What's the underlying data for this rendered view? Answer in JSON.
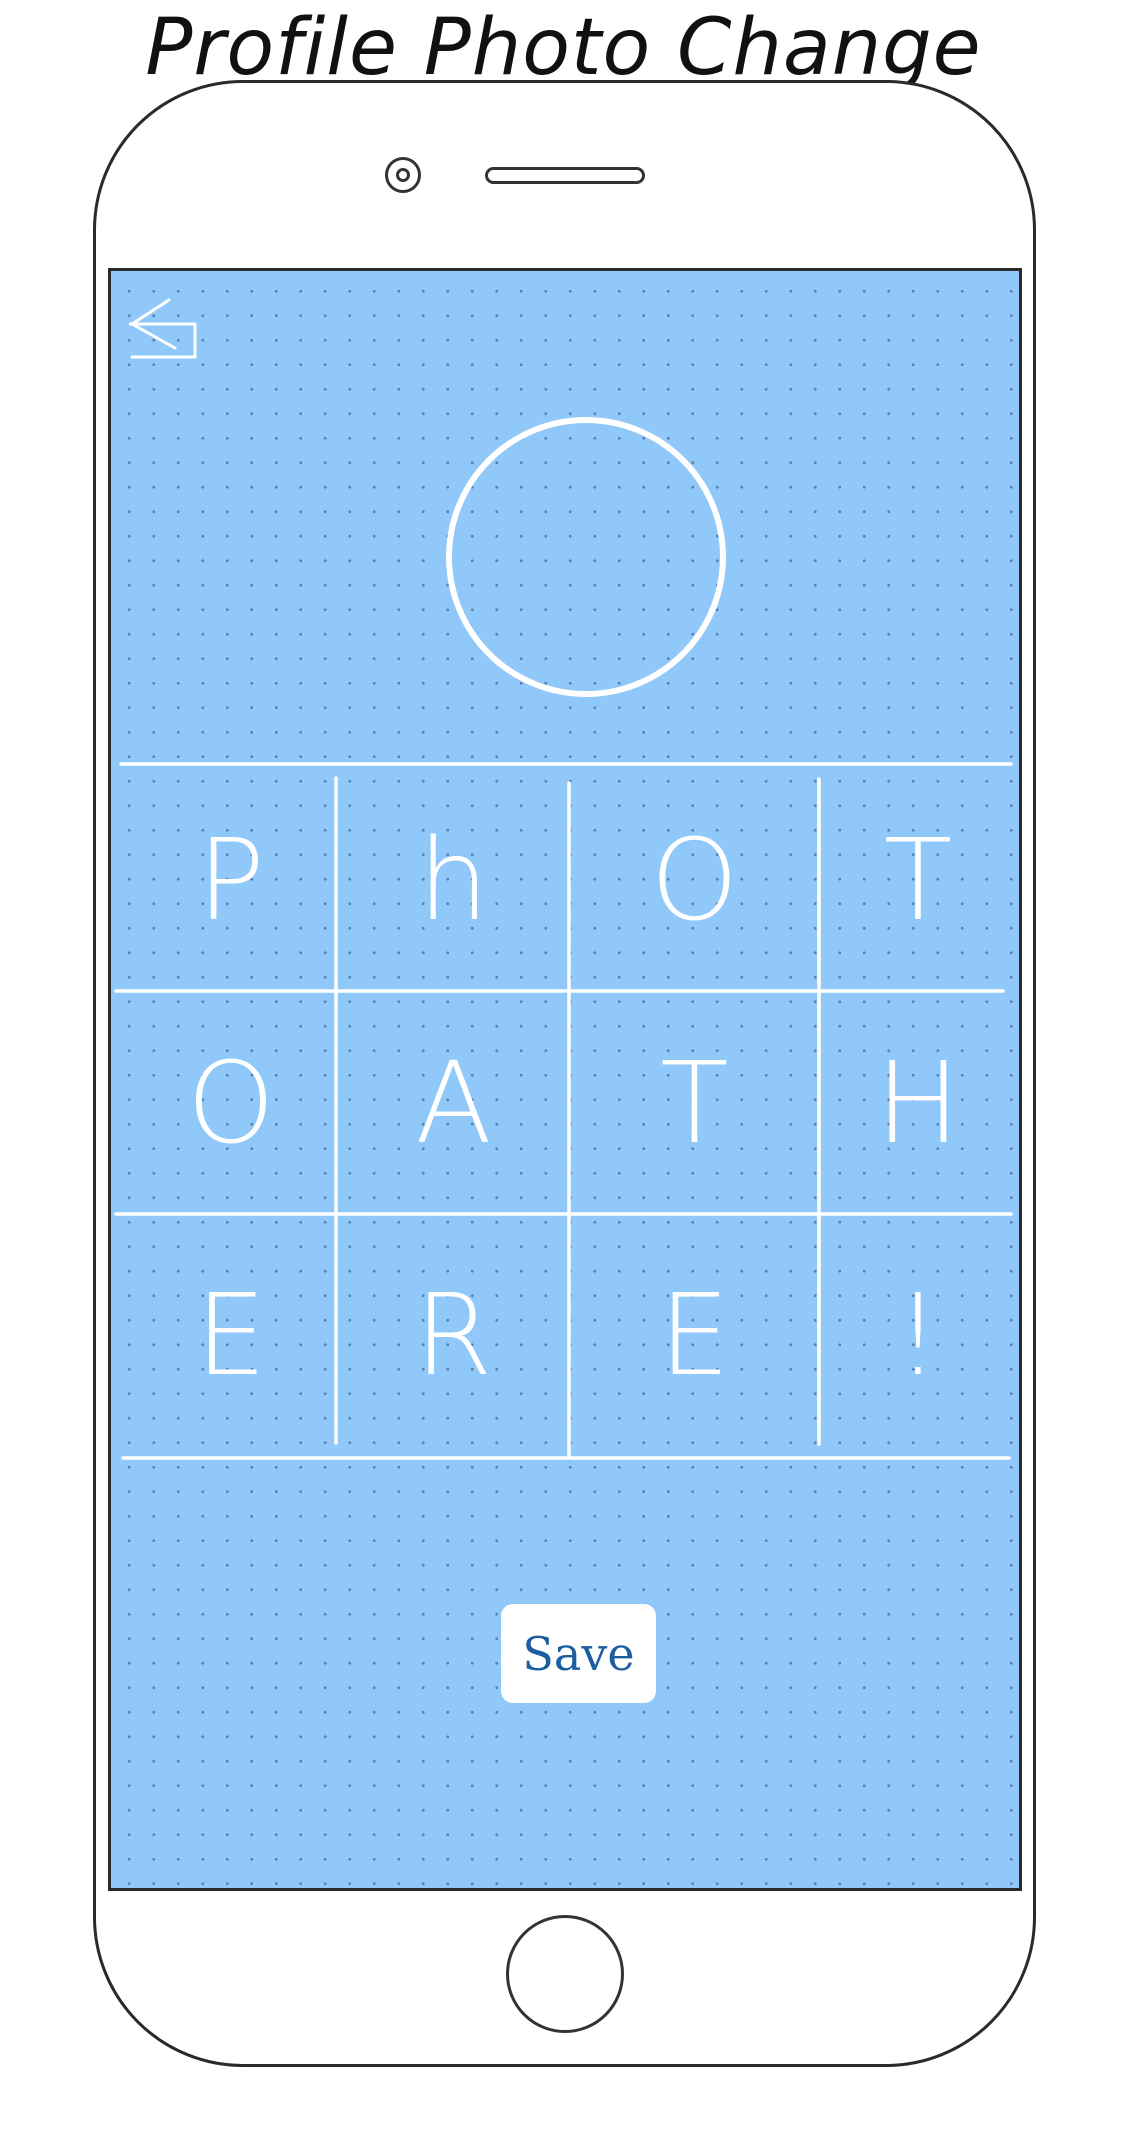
{
  "page": {
    "title": "Profile Photo Change"
  },
  "screen": {
    "background_color": "#91c8fa",
    "back_button": {
      "icon": "back-arrow-icon"
    },
    "profile_photo": {
      "icon": "photo-placeholder-circle"
    },
    "letter_grid": {
      "rows": [
        [
          "P",
          "h",
          "O",
          "T"
        ],
        [
          "O",
          "A",
          "T",
          "H"
        ],
        [
          "E",
          "R",
          "E",
          "!"
        ]
      ]
    },
    "save_button": {
      "label": "Save",
      "color": "#1c5ea0"
    }
  }
}
